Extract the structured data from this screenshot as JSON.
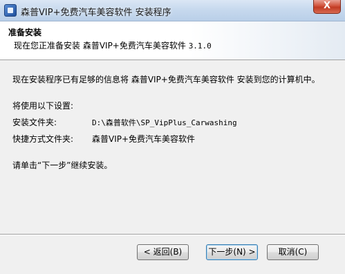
{
  "window": {
    "title": "森普VIP+免费汽车美容软件 安装程序",
    "close_glyph": "X"
  },
  "header": {
    "title": "准备安装",
    "subtitle_prefix": "现在您正准备安装 森普VIP+免费汽车美容软件",
    "version": "3.1.0"
  },
  "body": {
    "intro": "现在安装程序已有足够的信息将 森普VIP+免费汽车美容软件 安装到您的计算机中。",
    "settings_heading": "将使用以下设置:",
    "install_folder_label": "安装文件夹:",
    "install_folder_value": "D:\\森普软件\\SP_VipPlus_Carwashing",
    "shortcut_folder_label": "快捷方式文件夹:",
    "shortcut_folder_value": "森普VIP+免费汽车美容软件",
    "instruction": "请单击“下一步”继续安装。"
  },
  "buttons": {
    "back": "< 返回(B)",
    "next": "下一步(N) >",
    "cancel": "取消(C)"
  }
}
